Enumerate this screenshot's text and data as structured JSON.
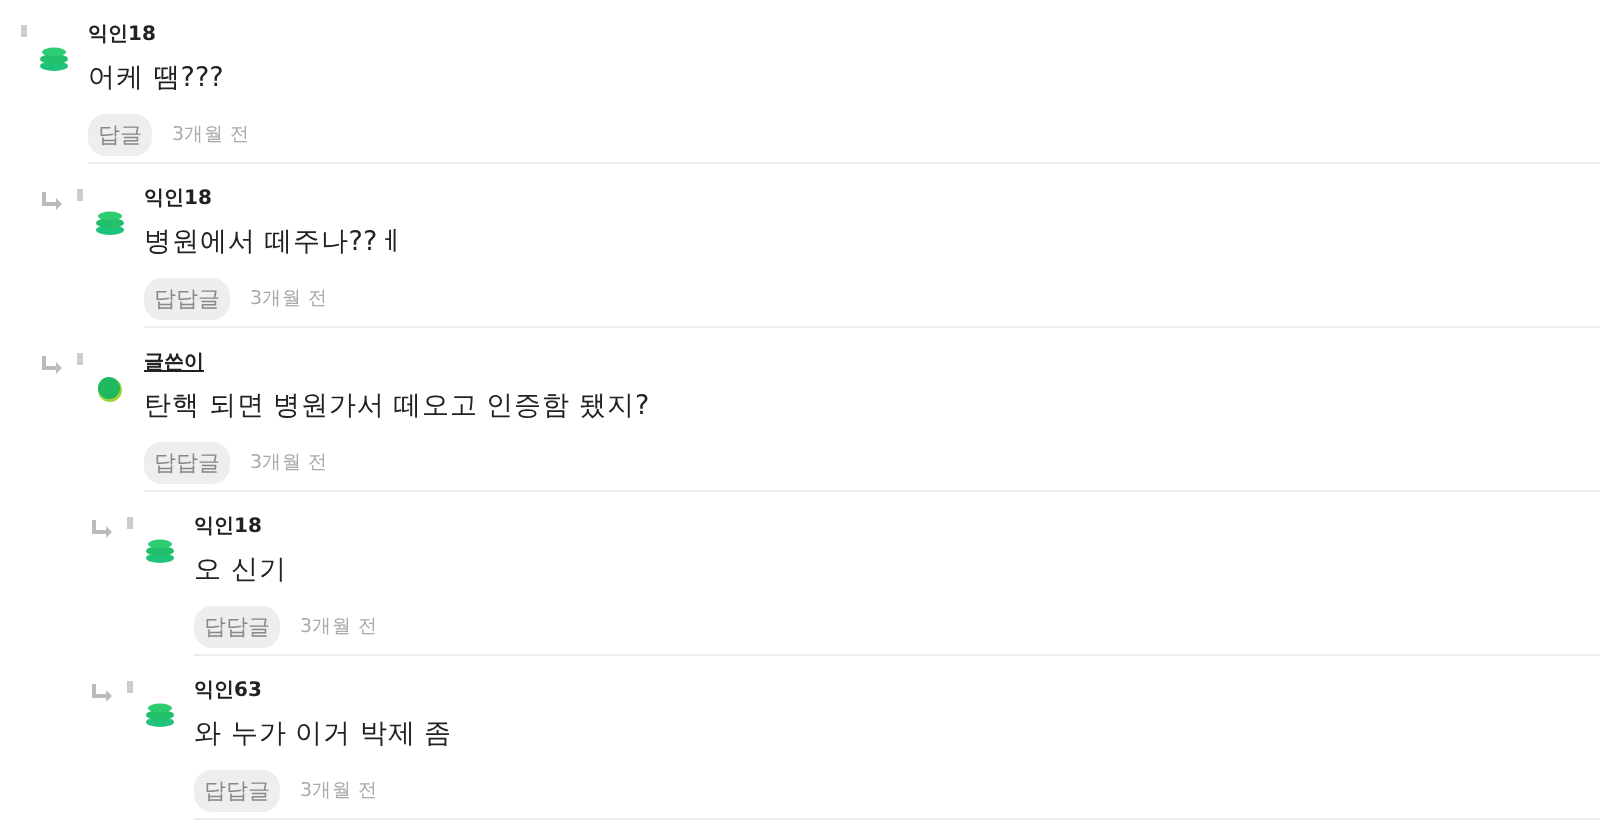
{
  "comments": [
    {
      "author": "익인18",
      "is_writer": false,
      "text": "어케 땜???",
      "reply_label": "답글",
      "time": "3개월 전",
      "children": [
        {
          "author": "익인18",
          "is_writer": false,
          "text": "병원에서 떼주나??ㅔ",
          "reply_label": "답답글",
          "time": "3개월 전"
        },
        {
          "author": "글쓴이",
          "is_writer": true,
          "text": "탄핵 되면 병원가서 떼오고 인증함 됐지?",
          "reply_label": "답답글",
          "time": "3개월 전",
          "children": [
            {
              "author": "익인18",
              "is_writer": false,
              "text": "오 신기",
              "reply_label": "답답글",
              "time": "3개월 전"
            },
            {
              "author": "익인63",
              "is_writer": false,
              "text": "와 누가 이거 박제 좀",
              "reply_label": "답답글",
              "time": "3개월 전"
            }
          ]
        }
      ]
    }
  ]
}
